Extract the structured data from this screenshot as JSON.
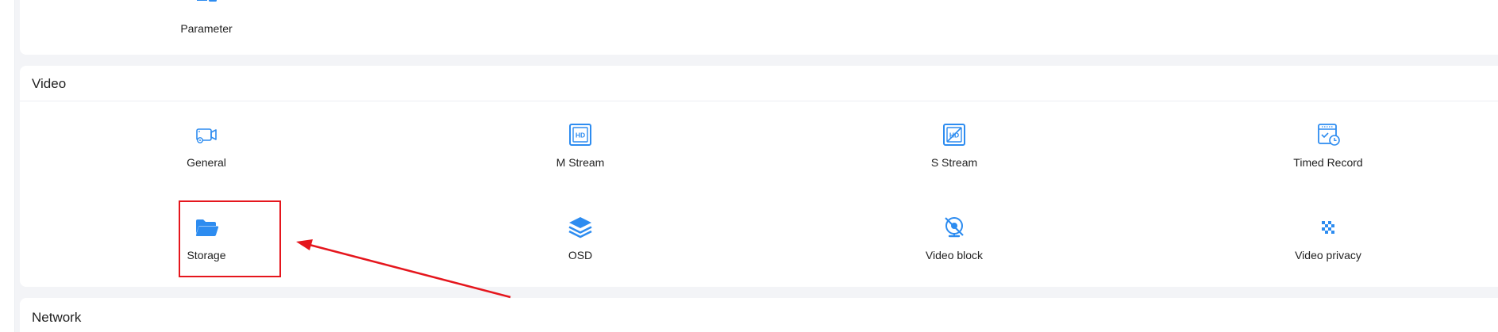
{
  "top_section": {
    "items": [
      {
        "label": "Parameter",
        "icon": "parameter-icon"
      }
    ]
  },
  "video_section": {
    "title": "Video",
    "items": [
      {
        "label": "General",
        "icon": "camera-settings-icon"
      },
      {
        "label": "M Stream",
        "icon": "hd-icon"
      },
      {
        "label": "S Stream",
        "icon": "hd-slash-icon"
      },
      {
        "label": "Timed Record",
        "icon": "calendar-clock-icon"
      },
      {
        "label": "Storage",
        "icon": "folder-icon"
      },
      {
        "label": "OSD",
        "icon": "layers-icon"
      },
      {
        "label": "Video block",
        "icon": "camera-blocked-icon"
      },
      {
        "label": "Video privacy",
        "icon": "mosaic-icon"
      }
    ]
  },
  "network_section": {
    "title": "Network"
  },
  "colors": {
    "icon_blue": "#2d8cf0",
    "annotation_red": "#e5161d",
    "page_background": "#f3f4f7"
  }
}
